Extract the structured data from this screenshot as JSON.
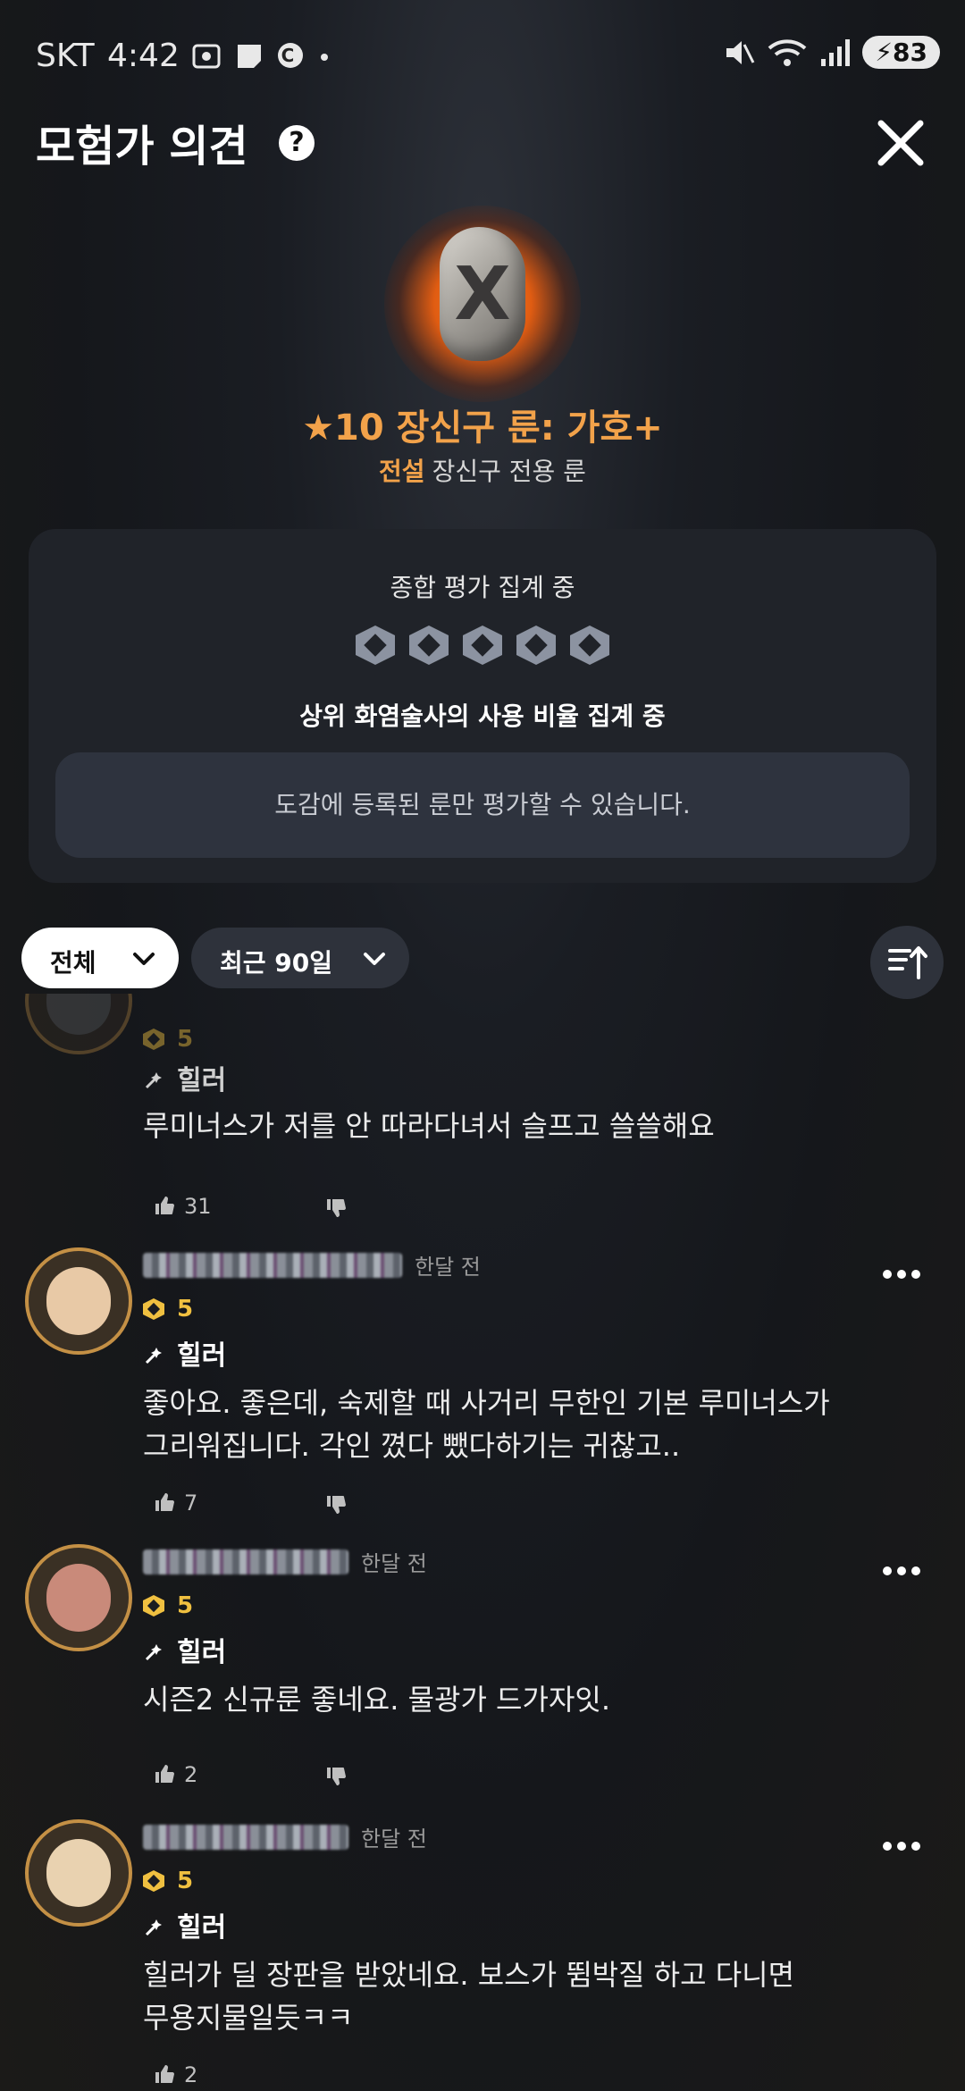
{
  "status_bar": {
    "carrier": "SKT",
    "time": "4:42",
    "battery": "83"
  },
  "header": {
    "title": "모험가 의견",
    "help_label": "?"
  },
  "rune": {
    "name": "★10 장신구 룬: 가호+",
    "grade": "전설",
    "type": "장신구 전용 룬"
  },
  "rating_card": {
    "title": "종합 평가 집계 중",
    "ratio_text": "상위 화염술사의 사용 비율 집계 중",
    "notice": "도감에 등록된 룬만 평가할 수 있습니다."
  },
  "filters": {
    "category": "전체",
    "period": "최근 90일"
  },
  "comments": [
    {
      "grade": "5",
      "role": "힐러",
      "text": "루미너스가 저를 안 따라다녀서 슬프고 쓸쓸해요",
      "likes": "31",
      "time": ""
    },
    {
      "grade": "5",
      "role": "힐러",
      "text": "좋아요. 좋은데, 숙제할 때 사거리 무한인 기본 루미너스가 그리워집니다. 각인 꼈다 뺐다하기는 귀찮고..",
      "likes": "7",
      "time": "한달 전"
    },
    {
      "grade": "5",
      "role": "힐러",
      "text": "시즌2 신규룬 좋네요. 물광가 드가자잇.",
      "likes": "2",
      "time": "한달 전"
    },
    {
      "grade": "5",
      "role": "힐러",
      "text": "힐러가 딜 장판을 받았네요. 보스가 뜀박질 하고 다니면 무용지물일듯ㅋㅋ",
      "likes": "2",
      "time": "한달 전"
    }
  ],
  "colors": {
    "accent": "#f2a24a",
    "card_bg": "#202329",
    "gem_gold": "#f0c040"
  }
}
